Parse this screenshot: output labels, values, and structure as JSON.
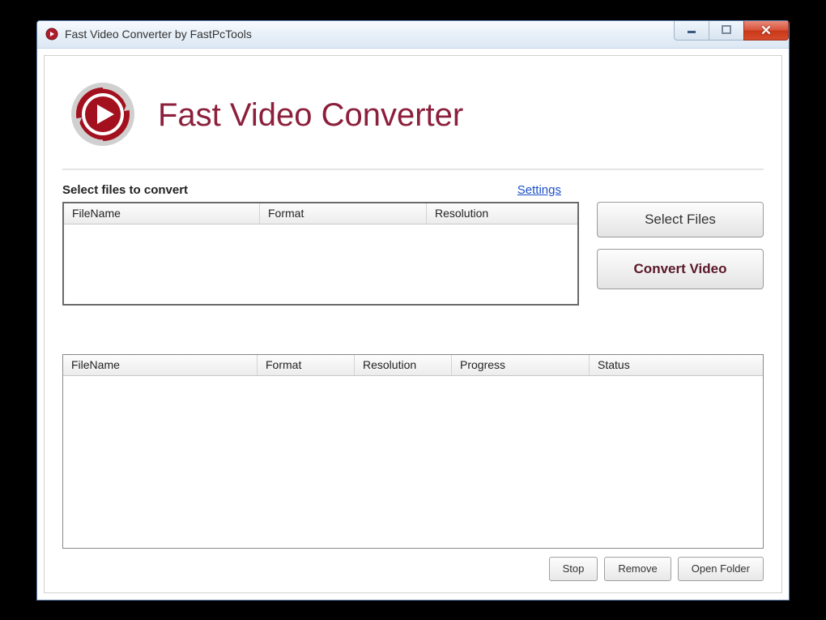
{
  "titlebar": {
    "title": "Fast Video Converter by FastPcTools"
  },
  "header": {
    "app_name": "Fast Video Converter"
  },
  "input_section": {
    "label": "Select files to convert",
    "settings_link": "Settings",
    "columns": {
      "filename": "FileName",
      "format": "Format",
      "resolution": "Resolution"
    }
  },
  "buttons": {
    "select_files": "Select Files",
    "convert_video": "Convert Video",
    "stop": "Stop",
    "remove": "Remove",
    "open_folder": "Open Folder"
  },
  "output_section": {
    "columns": {
      "filename": "FileName",
      "format": "Format",
      "resolution": "Resolution",
      "progress": "Progress",
      "status": "Status"
    }
  }
}
